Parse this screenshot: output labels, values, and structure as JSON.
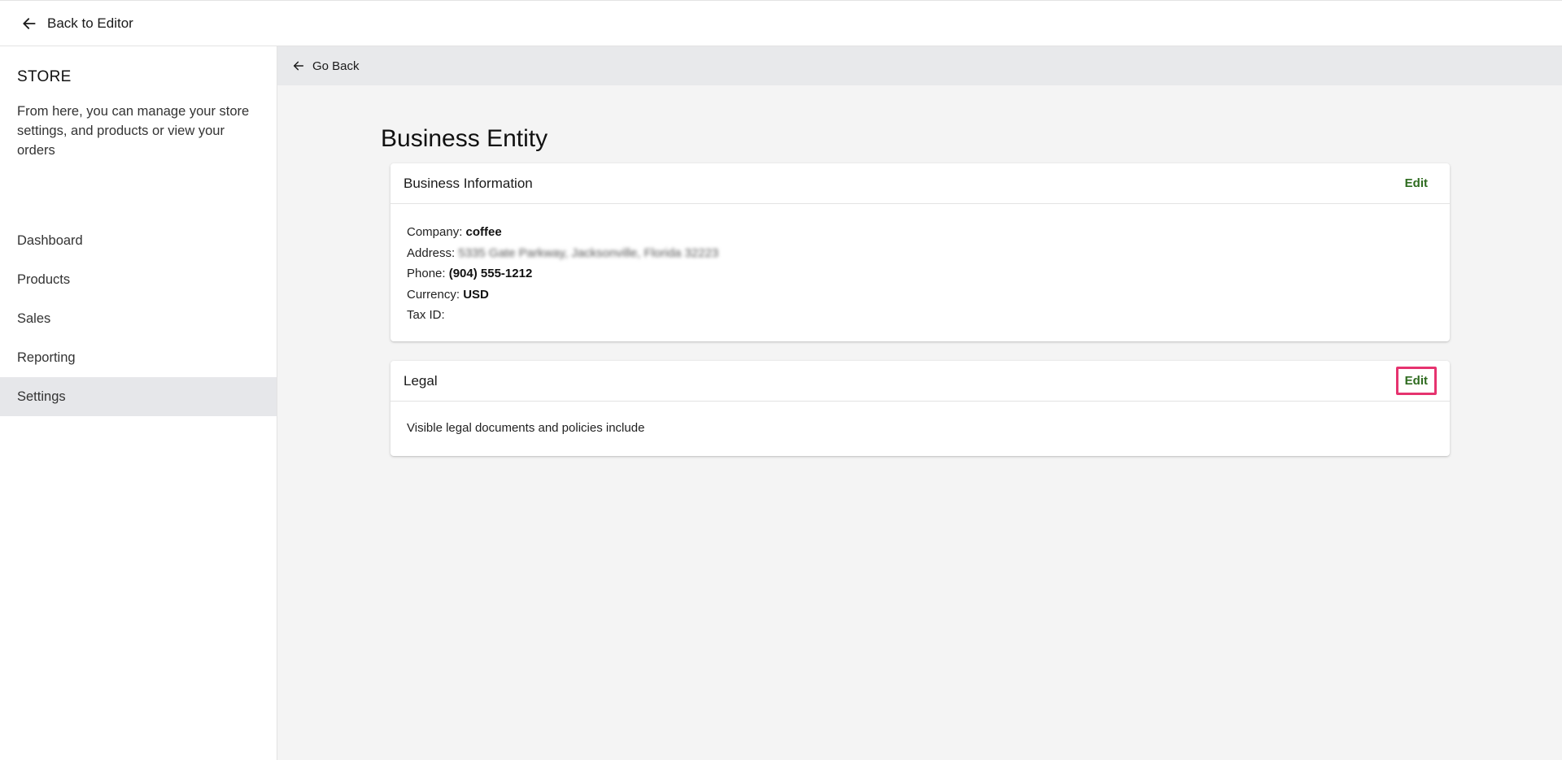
{
  "topbar": {
    "back_label": "Back to Editor"
  },
  "sidebar": {
    "title": "STORE",
    "description": "From here, you can manage your store settings, and products or view your orders",
    "items": [
      {
        "label": "Dashboard",
        "active": false
      },
      {
        "label": "Products",
        "active": false
      },
      {
        "label": "Sales",
        "active": false
      },
      {
        "label": "Reporting",
        "active": false
      },
      {
        "label": "Settings",
        "active": true
      }
    ]
  },
  "main": {
    "go_back_label": "Go Back",
    "page_title": "Business Entity",
    "business_info": {
      "title": "Business Information",
      "edit_label": "Edit",
      "company_label": "Company:",
      "company_value": "coffee",
      "address_label": "Address:",
      "address_value": "5335 Gate Parkway, Jacksonville, Florida 32223",
      "phone_label": "Phone:",
      "phone_value": "(904) 555-1212",
      "currency_label": "Currency:",
      "currency_value": "USD",
      "tax_label": "Tax ID:",
      "tax_value": ""
    },
    "legal": {
      "title": "Legal",
      "edit_label": "Edit",
      "body": "Visible legal documents and policies include"
    }
  },
  "colors": {
    "accent_green": "#2e6b1f",
    "highlight_pink": "#e6336f",
    "active_nav_bg": "#e6e7ea",
    "main_bg": "#f4f4f4"
  }
}
